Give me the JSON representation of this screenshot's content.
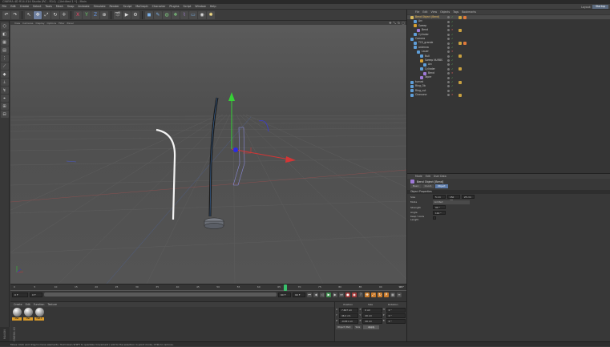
{
  "app": {
    "title": "CINEMA 4D R14.014 Studio (RC - R14) - [Untitled 1 *] - Main",
    "menu": [
      "File",
      "Edit",
      "Create",
      "Select",
      "Tools",
      "Mesh",
      "Snap",
      "Animate",
      "Simulate",
      "Render",
      "Sculpt",
      "MoGraph",
      "Character",
      "Plugins",
      "Script",
      "Window",
      "Help"
    ],
    "layout_label": "Layout:",
    "layout_value": "Startup"
  },
  "viewport": {
    "menu": [
      "View",
      "Cameras",
      "Display",
      "Options",
      "Filter",
      "Panel"
    ]
  },
  "timeline": {
    "ticks": [
      "0",
      "5",
      "10",
      "15",
      "20",
      "25",
      "30",
      "35",
      "40",
      "45",
      "50",
      "55",
      "60",
      "65",
      "70",
      "75",
      "80",
      "85",
      "90",
      "95"
    ],
    "end_label": "90 F",
    "start_field": "0 F",
    "min_field": "0 F",
    "max_field": "90 F",
    "end_field": "90 F",
    "current_frame": 67,
    "frame_max": 90
  },
  "materials": {
    "menu": [
      "Create",
      "Edit",
      "Function",
      "Texture"
    ],
    "items": [
      {
        "label": "Mat"
      },
      {
        "label": "Mat"
      },
      {
        "label": "Mat.1"
      }
    ]
  },
  "coordinates": {
    "headers": [
      "Position",
      "Size",
      "Rotation"
    ],
    "rows": [
      [
        "X",
        "7.607 cm",
        "X",
        "0 cm",
        "H",
        "0 °"
      ],
      [
        "Y",
        "46.2 cm",
        "Y",
        "20 cm",
        "P",
        "0 °"
      ],
      [
        "Z",
        "-0.831 cm",
        "Z",
        "20 cm",
        "B",
        "0 °"
      ]
    ],
    "object_mode": "Object (Rel)",
    "size_mode": "Size",
    "apply_label": "Apply"
  },
  "object_manager": {
    "menu": [
      "File",
      "Edit",
      "View",
      "Objects",
      "Tags",
      "Bookmarks"
    ],
    "items": [
      {
        "name": "Bend Object (Bend)",
        "depth": 0,
        "color": "#d8b85a"
      },
      {
        "name": "Arc",
        "depth": 1,
        "color": "#5f9ed8"
      },
      {
        "name": "Sweep",
        "depth": 1,
        "color": "#d8a030"
      },
      {
        "name": "Bend",
        "depth": 2,
        "color": "#9f7ad8"
      },
      {
        "name": "Cylinder",
        "depth": 1,
        "color": "#5f9ed8"
      },
      {
        "name": "Camera",
        "depth": 0,
        "color": "#5f9ed8"
      },
      {
        "name": "TCS_grande",
        "depth": 1,
        "color": "#5f9ed8"
      },
      {
        "name": "antenna",
        "depth": 1,
        "color": "#5f9ed8"
      },
      {
        "name": "Lauer",
        "depth": 2,
        "color": "#5f9ed8"
      },
      {
        "name": "Null",
        "depth": 3,
        "color": "#5f9ed8"
      },
      {
        "name": "Sweep NURBS",
        "depth": 3,
        "color": "#d8a030"
      },
      {
        "name": "Arc",
        "depth": 4,
        "color": "#5f9ed8"
      },
      {
        "name": "Cylinder",
        "depth": 3,
        "color": "#5f9ed8"
      },
      {
        "name": "Bend",
        "depth": 4,
        "color": "#9f7ad8"
      },
      {
        "name": "Taper",
        "depth": 3,
        "color": "#9f7ad8"
      },
      {
        "name": "turned",
        "depth": 0,
        "color": "#5f9ed8"
      },
      {
        "name": "Ring_Ob",
        "depth": 0,
        "color": "#5f9ed8"
      },
      {
        "name": "Ring_cut",
        "depth": 0,
        "color": "#5f9ed8"
      },
      {
        "name": "Cinecone",
        "depth": 0,
        "color": "#5f9ed8"
      }
    ]
  },
  "attribute_manager": {
    "menu": [
      "Mode",
      "Edit",
      "User Data"
    ],
    "title": "Bend Object [Bend]",
    "tabs": [
      "Basic",
      "Coord.",
      "Object"
    ],
    "section": "Object Properties",
    "props": [
      {
        "label": "Size",
        "values": [
          "5 cm",
          "150 cm",
          "25 cm"
        ]
      },
      {
        "label": "Mode",
        "select": "Limited"
      },
      {
        "label": "Strength",
        "values": [
          "90 °"
        ]
      },
      {
        "label": "Angle",
        "values": [
          "110 °"
        ]
      },
      {
        "label": "Keep Y-Axis Length",
        "values": []
      }
    ]
  },
  "status": {
    "text": "Move: Click and drag to move elements. Hold down SHIFT to quantize movement / add to the selection in point mode, CTRL to remove."
  },
  "brand": {
    "logo_text": "MAXON CINEMA 4D"
  }
}
